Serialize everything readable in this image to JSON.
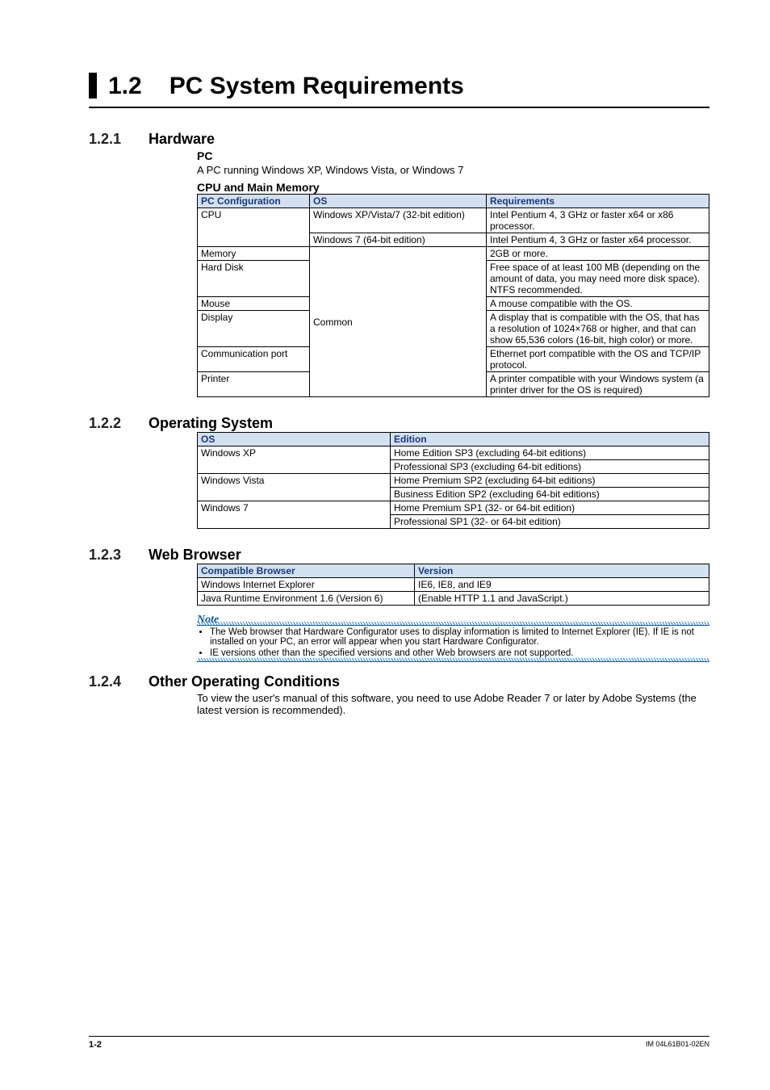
{
  "header": {
    "num": "1.2",
    "title": "PC System Requirements"
  },
  "s121": {
    "num": "1.2.1",
    "title": "Hardware",
    "pc_label": "PC",
    "pc_text": "A PC running Windows XP, Windows Vista, or Windows 7",
    "cpu_label": "CPU and Main Memory",
    "cols": {
      "c1": "PC Configuration",
      "c2": "OS",
      "c3": "Requirements"
    },
    "r1": {
      "c1": "CPU",
      "c2": "Windows XP/Vista/7 (32-bit edition)",
      "c3": "Intel Pentium 4, 3 GHz or faster x64 or x86 processor."
    },
    "r2": {
      "c2": "Windows 7 (64-bit edition)",
      "c3": "Intel Pentium 4, 3 GHz or faster x64 processor."
    },
    "common": "Common",
    "r3": {
      "c1": "Memory",
      "c3": "2GB or more."
    },
    "r4": {
      "c1": "Hard Disk",
      "c3": "Free space of at least 100 MB (depending on the amount of data, you may need more disk space). NTFS recommended."
    },
    "r5": {
      "c1": "Mouse",
      "c3": "A mouse compatible with the OS."
    },
    "r6": {
      "c1": "Display",
      "c3": "A display that is compatible with the OS, that has a resolution of 1024×768 or higher, and that can show 65,536 colors (16-bit, high color) or more."
    },
    "r7": {
      "c1": "Communication port",
      "c3": "Ethernet port compatible with the OS and TCP/IP protocol."
    },
    "r8": {
      "c1": "Printer",
      "c3": "A printer compatible with your Windows system (a printer driver for the OS is required)"
    }
  },
  "s122": {
    "num": "1.2.2",
    "title": "Operating System",
    "cols": {
      "c1": "OS",
      "c2": "Edition"
    },
    "r1": {
      "c1": "Windows XP",
      "c2": "Home Edition SP3 (excluding 64-bit editions)"
    },
    "r2": {
      "c2": "Professional SP3 (excluding 64-bit editions)"
    },
    "r3": {
      "c1": "Windows Vista",
      "c2": "Home Premium SP2 (excluding 64-bit editions)"
    },
    "r4": {
      "c2": "Business Edition SP2 (excluding 64-bit editions)"
    },
    "r5": {
      "c1": "Windows 7",
      "c2": "Home Premium SP1 (32- or 64-bit edition)"
    },
    "r6": {
      "c2": "Professional SP1 (32- or 64-bit edition)"
    }
  },
  "s123": {
    "num": "1.2.3",
    "title": "Web Browser",
    "cols": {
      "c1": "Compatible Browser",
      "c2": "Version"
    },
    "r1": {
      "c1": "Windows Internet Explorer",
      "c2": "IE6, IE8, and IE9"
    },
    "r2": {
      "c1": "Java Runtime Environment 1.6 (Version 6)",
      "c2": "(Enable HTTP 1.1 and JavaScript.)"
    },
    "note_label": "Note",
    "note1": "The Web browser that Hardware Configurator uses to display information is limited to Internet Explorer (IE). If IE is not installed on your PC, an error will appear when you start Hardware Configurator.",
    "note2": "IE versions other than the specified versions and other Web browsers are not supported."
  },
  "s124": {
    "num": "1.2.4",
    "title": "Other Operating Conditions",
    "text": "To view the user's manual of this software, you need to use Adobe Reader 7 or later by Adobe Systems (the latest version is recommended)."
  },
  "footer": {
    "page": "1-2",
    "doc": "IM 04L61B01-02EN"
  }
}
